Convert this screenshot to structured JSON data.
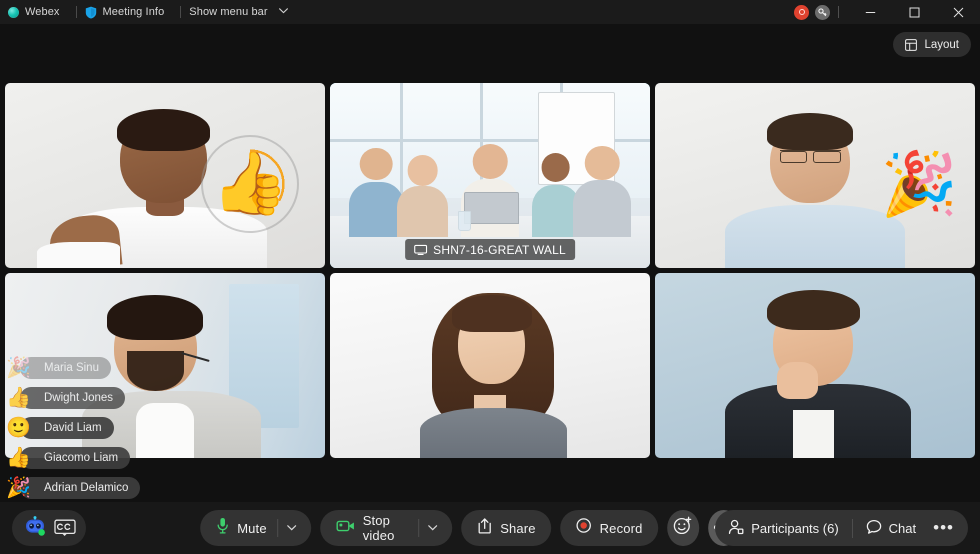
{
  "titlebar": {
    "app_name": "Webex",
    "meeting_info_label": "Meeting Info",
    "show_menu_bar_label": "Show menu bar",
    "caret": "∨",
    "icons": {
      "webex_logo": "webex-logo-icon",
      "meeting_info": "shield-icon",
      "recording_badge": "recording-indicator-icon",
      "encryption_badge": "key-icon",
      "minimize": "minimize-icon",
      "maximize": "maximize-icon",
      "close": "close-icon"
    }
  },
  "layout_button": {
    "label": "Layout",
    "icon": "grid-layout-icon"
  },
  "grid": {
    "tiles": [
      {
        "id": "tile-1",
        "name": "",
        "active": false,
        "reaction": "👍",
        "reaction_type": "thumbs-up",
        "has_name_pill": false
      },
      {
        "id": "tile-2",
        "name": "SHN7-16-GREAT WALL",
        "active": true,
        "reaction": "",
        "reaction_type": "",
        "has_name_pill": true
      },
      {
        "id": "tile-3",
        "name": "",
        "active": false,
        "reaction": "🎉",
        "reaction_type": "party-popper",
        "has_name_pill": false
      },
      {
        "id": "tile-4",
        "name": "",
        "active": false,
        "reaction": "",
        "reaction_type": "",
        "has_name_pill": false
      },
      {
        "id": "tile-5",
        "name": "",
        "active": false,
        "reaction": "",
        "reaction_type": "",
        "has_name_pill": false
      },
      {
        "id": "tile-6",
        "name": "",
        "active": false,
        "reaction": "",
        "reaction_type": "",
        "has_name_pill": false
      }
    ],
    "active_border_color": "#00b7eb"
  },
  "reaction_toasts": [
    {
      "name": "Maria Sinu",
      "emoji": "🎉",
      "emoji_name": "party-popper-icon",
      "opacity": "fading-out"
    },
    {
      "name": "Dwight Jones",
      "emoji": "👍",
      "emoji_name": "thumbs-up-icon",
      "opacity": "fading"
    },
    {
      "name": "David Liam",
      "emoji": "🙂",
      "emoji_name": "smiley-icon",
      "opacity": "full"
    },
    {
      "name": "Giacomo Liam",
      "emoji": "👍",
      "emoji_name": "thumbs-up-icon",
      "opacity": "full"
    },
    {
      "name": "Adrian Delamico",
      "emoji": "🎉",
      "emoji_name": "party-popper-icon",
      "opacity": "full"
    }
  ],
  "toolbar": {
    "assistant_icon": "webex-assistant-icon",
    "captions_icon": "closed-captions-icon",
    "mute": {
      "label": "Mute",
      "icon": "microphone-icon",
      "icon_color": "#3ecf6d",
      "caret": "⌄"
    },
    "video": {
      "label": "Stop video",
      "icon": "camera-icon",
      "icon_color": "#3ecf6d",
      "caret": "⌄"
    },
    "share": {
      "label": "Share",
      "icon": "share-upload-icon"
    },
    "record": {
      "label": "Record",
      "icon": "record-dot-icon",
      "icon_color": "#e0422f"
    },
    "reactions": {
      "icon": "smiley-plus-icon"
    },
    "more": {
      "icon": "ellipsis-icon",
      "label": "•••"
    },
    "end_call": {
      "icon": "close-icon"
    },
    "participants": {
      "label": "Participants (6)",
      "icon": "person-icon"
    },
    "chat": {
      "label": "Chat",
      "icon": "chat-bubble-icon"
    },
    "more_right": {
      "icon": "ellipsis-icon",
      "label": "•••"
    }
  },
  "colors": {
    "accent_blue": "#00b7eb",
    "danger_red": "#d8432b",
    "mic_green": "#3ecf6d",
    "window_bg": "#111111",
    "toolbar_bg": "#181818"
  }
}
